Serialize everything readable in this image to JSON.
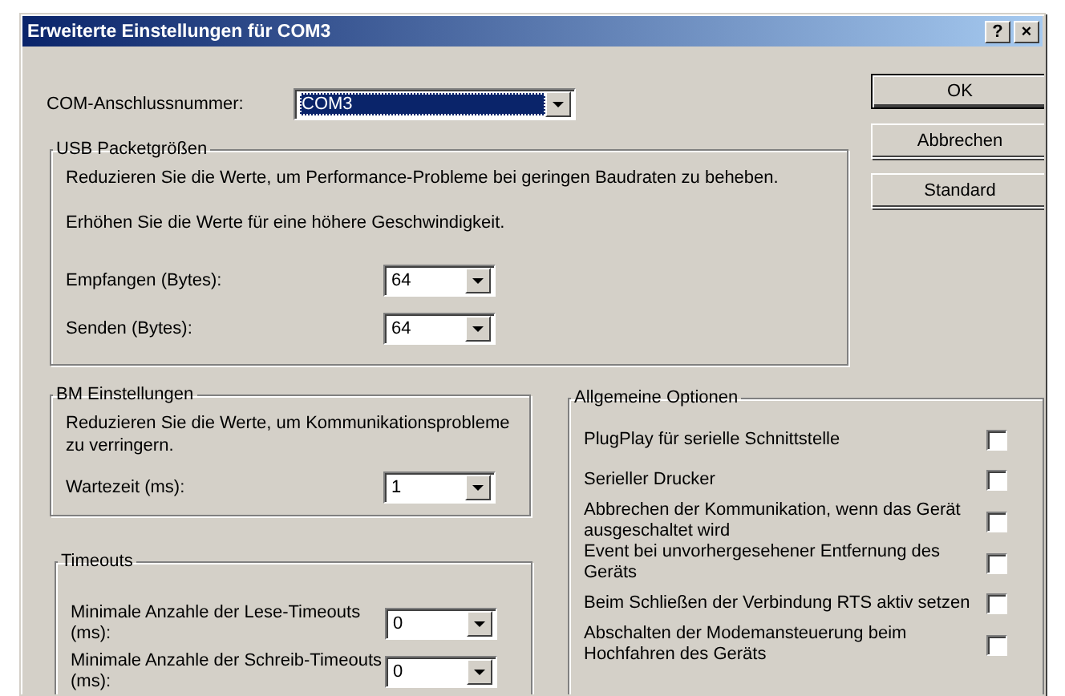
{
  "window": {
    "title": "Erweiterte Einstellungen für COM3",
    "help_glyph": "?",
    "close_glyph": "×"
  },
  "com_port": {
    "label": "COM-Anschlussnummer:",
    "value": "COM3",
    "highlighted": true
  },
  "buttons": [
    {
      "label": "OK",
      "default": true
    },
    {
      "label": "Abbrechen",
      "default": false
    },
    {
      "label": "Standard",
      "default": false
    }
  ],
  "usb_group": {
    "title": "USB Packetgrößen",
    "notes": [
      "Reduzieren Sie die Werte, um Performance-Probleme bei geringen Baudraten zu beheben.",
      "Erhöhen Sie die Werte für eine höhere Geschwindigkeit."
    ],
    "fields": [
      {
        "label": "Empfangen (Bytes):",
        "value": "64"
      },
      {
        "label": "Senden (Bytes):",
        "value": "64"
      }
    ]
  },
  "bm_group": {
    "title": "BM Einstellungen",
    "notes": [
      "Reduzieren Sie die Werte, um Kommunikationsprobleme zu verringern."
    ],
    "fields": [
      {
        "label": "Wartezeit (ms):",
        "value": "1"
      }
    ]
  },
  "timeouts_group": {
    "title": "Timeouts",
    "fields": [
      {
        "label": "Minimale Anzahle der Lese-Timeouts (ms):",
        "value": "0"
      },
      {
        "label": "Minimale Anzahle der Schreib-Timeouts (ms):",
        "value": "0"
      }
    ]
  },
  "options_group": {
    "title": "Allgemeine Optionen",
    "options": [
      {
        "label": "PlugPlay für serielle Schnittstelle",
        "checked": false
      },
      {
        "label": "Serieller Drucker",
        "checked": false
      },
      {
        "label": "Abbrechen der Kommunikation, wenn das Gerät ausgeschaltet wird",
        "checked": false
      },
      {
        "label": "Event bei unvorhergesehener Entfernung des Geräts",
        "checked": false
      },
      {
        "label": "Beim Schließen der Verbindung RTS aktiv setzen",
        "checked": false
      },
      {
        "label": "Abschalten der Modemansteuerung beim Hochfahren des Geräts",
        "checked": false
      }
    ]
  }
}
